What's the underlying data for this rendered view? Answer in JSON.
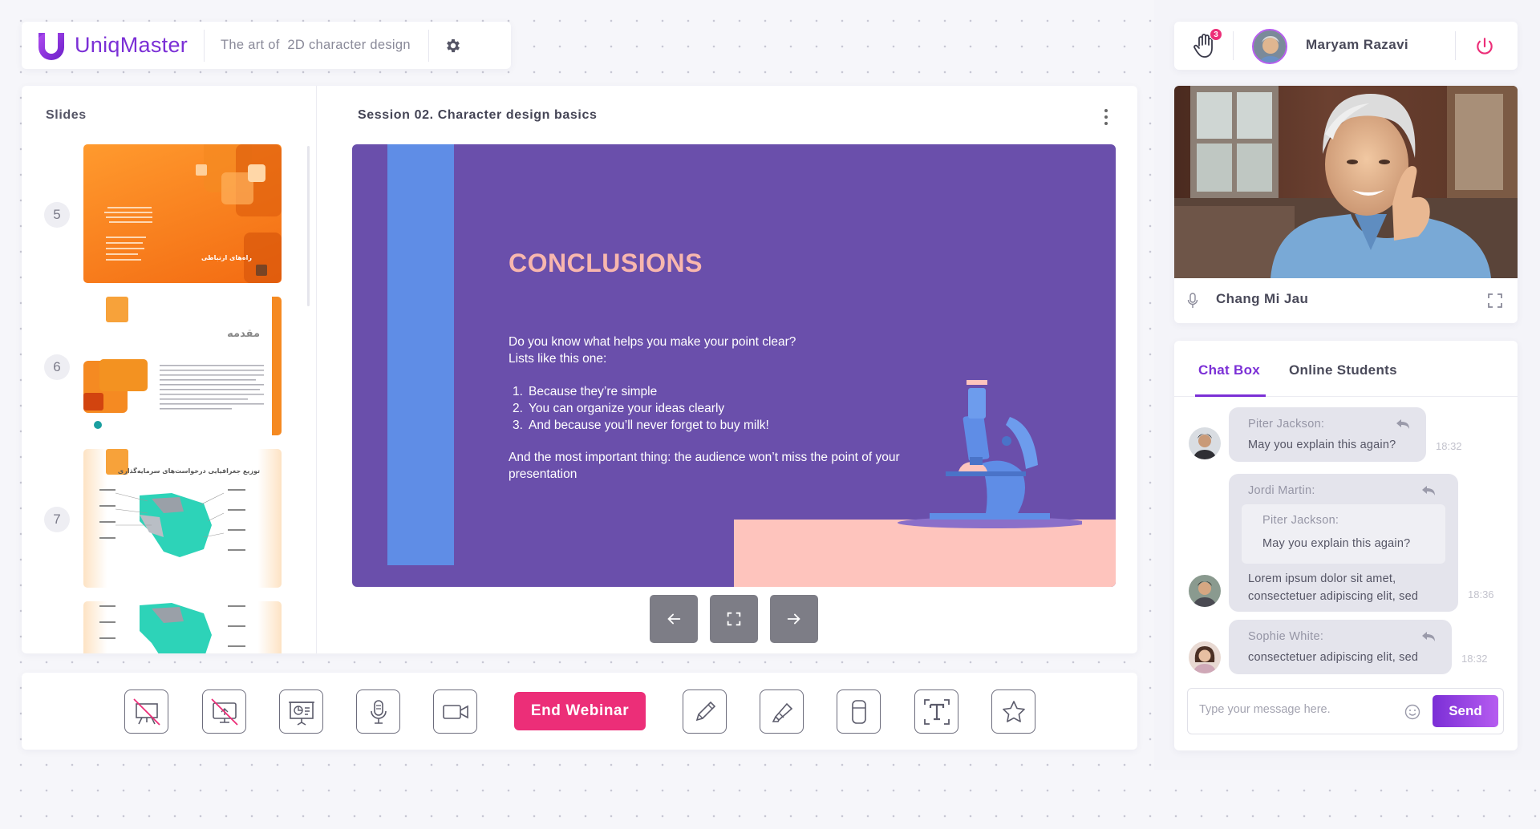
{
  "app": {
    "logo_text": "UniqMaster",
    "course_title": "The art of  2D character design"
  },
  "slides_panel": {
    "title": "Slides",
    "items": [
      {
        "number": "5",
        "thumb_text": "راه‌های ارتباطی"
      },
      {
        "number": "6",
        "thumb_text": "مقدمه"
      },
      {
        "number": "7",
        "thumb_text": "توزیع جغرافیایی درخواست‌های سرمایه‌گذاری"
      },
      {
        "number": "8",
        "thumb_text": ""
      }
    ]
  },
  "presentation": {
    "session_title": "Session 02. Character design basics",
    "slide": {
      "heading": "CONCLUSIONS",
      "intro_line1": "Do you know what helps you make your point clear?",
      "intro_line2": "Lists like this one:",
      "list": [
        "Because they’re simple",
        "You can organize your ideas clearly",
        "And because you’ll never forget to buy milk!"
      ],
      "outro_line1": "And the most important thing: the audience won’t miss the point of your",
      "outro_line2": "presentation",
      "colors": {
        "background": "#6a4fab",
        "accent_bar": "#5f8de6",
        "floor": "#fec4bd",
        "heading": "#f8b7ae"
      }
    },
    "controls": [
      "prev-arrow-icon",
      "fullscreen-icon",
      "next-arrow-icon"
    ]
  },
  "toolbar": {
    "tools": [
      "whiteboard-off-icon",
      "screen-share-off-icon",
      "presentation-icon",
      "microphone-icon",
      "video-camera-icon",
      "pencil-icon",
      "highlighter-icon",
      "eraser-icon",
      "text-tool-icon",
      "star-icon"
    ],
    "end_webinar_label": "End Webinar",
    "accent_color": "#ec2e78"
  },
  "user_bar": {
    "raised_hands_count": "3",
    "user_name": "Maryam Razavi"
  },
  "video": {
    "participant_name": "Chang Mi Jau"
  },
  "chat": {
    "tabs": [
      {
        "label": "Chat Box",
        "active": true
      },
      {
        "label": "Online Students",
        "active": false
      }
    ],
    "messages": [
      {
        "sender": "Piter Jackson:",
        "text": "May you explain this again?",
        "time": "18:32"
      },
      {
        "sender": "Jordi Martin:",
        "quote_sender": "Piter Jackson:",
        "quote_text": "May you explain this again?",
        "text_line1": "Lorem ipsum dolor sit amet,",
        "text_line2": "consectetuer adipiscing elit, sed",
        "time": "18:36"
      },
      {
        "sender": "Sophie White:",
        "text": "consectetuer adipiscing elit, sed",
        "time": "18:32"
      }
    ],
    "input_placeholder": "Type your message here.",
    "send_label": "Send",
    "accent_color": "#7b2fd6"
  }
}
